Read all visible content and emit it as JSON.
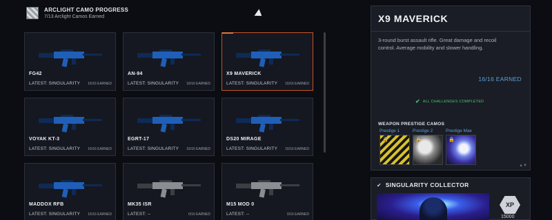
{
  "header": {
    "title": "ARCLIGHT CAMO PROGRESS",
    "subtitle": "7/13 Arclight Camos Earned"
  },
  "weapons": [
    {
      "name": "FG42",
      "latest": "LATEST: SINGULARITY",
      "earned": "16/16 EARNED",
      "camo": "blue",
      "selected": false
    },
    {
      "name": "AN-94",
      "latest": "LATEST: SINGULARITY",
      "earned": "16/16 EARNED",
      "camo": "blue",
      "selected": false
    },
    {
      "name": "X9 MAVERICK",
      "latest": "LATEST: SINGULARITY",
      "earned": "16/16 EARNED",
      "camo": "blue",
      "selected": true
    },
    {
      "name": "VOYAK KT-3",
      "latest": "LATEST: SINGULARITY",
      "earned": "16/16 EARNED",
      "camo": "blue",
      "selected": false
    },
    {
      "name": "EGRT-17",
      "latest": "LATEST: SINGULARITY",
      "earned": "16/16 EARNED",
      "camo": "blue",
      "selected": false
    },
    {
      "name": "DS20 MIRAGE",
      "latest": "LATEST: SINGULARITY",
      "earned": "16/16 EARNED",
      "camo": "blue",
      "selected": false
    },
    {
      "name": "MADDOX RFB",
      "latest": "LATEST: SINGULARITY",
      "earned": "16/16 EARNED",
      "camo": "blue",
      "selected": false
    },
    {
      "name": "MK35 ISR",
      "latest": "LATEST: --",
      "earned": "0/16 EARNED",
      "camo": "gray",
      "selected": false
    },
    {
      "name": "M15 MOD 0",
      "latest": "LATEST: --",
      "earned": "0/16 EARNED",
      "camo": "gray",
      "selected": false
    }
  ],
  "detail": {
    "title": "X9 MAVERICK",
    "description": "3-round burst assault rifle. Great damage and recoil control. Average mobility and slower handling.",
    "earned": "16/16 EARNED",
    "complete": "ALL CHALLENGES COMPLETED",
    "prestige_heading": "WEAPON PRESTIGE CAMOS",
    "prestige": [
      {
        "label": "Prestige 1"
      },
      {
        "label": "Prestige 2"
      },
      {
        "label": "Prestige Max"
      }
    ]
  },
  "collector": {
    "title": "SINGULARITY COLLECTOR",
    "xp_label": "XP",
    "xp_amount": "15000"
  },
  "colors": {
    "accent_selected": "#c9542c",
    "earned_blue": "#5fa0d8",
    "complete_green": "#44c46a",
    "camo_blue": "#1f5fb8",
    "camo_gray": "#8a8d92"
  }
}
